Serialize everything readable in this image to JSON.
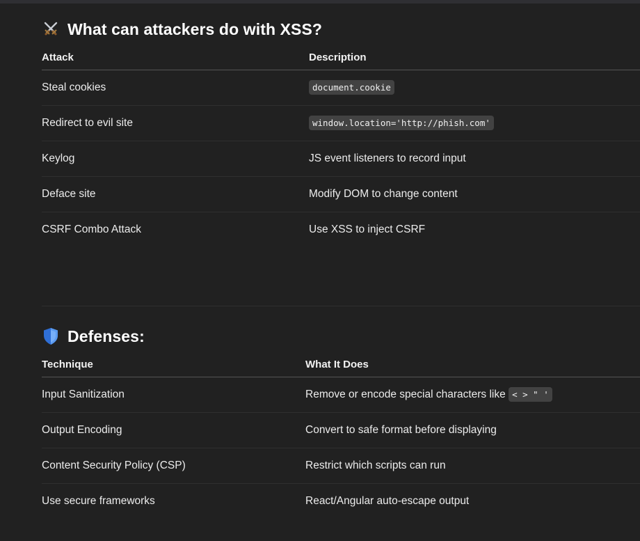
{
  "section_attacks": {
    "title": "What can attackers do with XSS?",
    "icon": "crossed-swords-icon",
    "columns": [
      "Attack",
      "Description"
    ],
    "rows": [
      {
        "attack": "Steal cookies",
        "description": "document.cookie",
        "code": true
      },
      {
        "attack": "Redirect to evil site",
        "description": "window.location='http://phish.com'",
        "code": true
      },
      {
        "attack": "Keylog",
        "description": "JS event listeners to record input",
        "code": false
      },
      {
        "attack": "Deface site",
        "description": "Modify DOM to change content",
        "code": false
      },
      {
        "attack": "CSRF Combo Attack",
        "description": "Use XSS to inject CSRF",
        "code": false
      }
    ]
  },
  "section_defenses": {
    "title": "Defenses:",
    "icon": "shield-icon",
    "columns": [
      "Technique",
      "What It Does"
    ],
    "rows": [
      {
        "technique": "Input Sanitization",
        "description": "Remove or encode special characters like",
        "code": "< > \" '"
      },
      {
        "technique": "Output Encoding",
        "description": "Convert to safe format before displaying"
      },
      {
        "technique": "Content Security Policy (CSP)",
        "description": "Restrict which scripts can run"
      },
      {
        "technique": "Use secure frameworks",
        "description": "React/Angular auto-escape output"
      }
    ]
  },
  "colors": {
    "background": "#212121",
    "code_bg": "#424242",
    "shield_blue": "#3b82f6"
  }
}
